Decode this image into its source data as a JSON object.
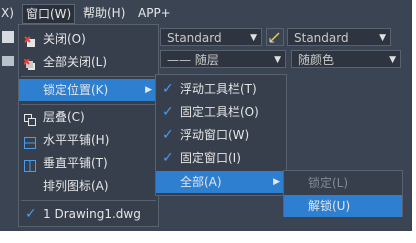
{
  "menubar": {
    "items": [
      {
        "label": "X)"
      },
      {
        "label": "窗口(W)"
      },
      {
        "label": "帮助(H)"
      },
      {
        "label": "APP+"
      }
    ]
  },
  "toolbar": {
    "combo_standard_1": "Standard",
    "combo_standard_2": "Standard",
    "combo_layer": "—— 随层",
    "combo_color": "随颜色"
  },
  "window_menu": {
    "items": [
      {
        "label": "关闭(O)"
      },
      {
        "label": "全部关闭(L)"
      },
      {
        "label": "锁定位置(K)"
      },
      {
        "label": "层叠(C)"
      },
      {
        "label": "水平平铺(H)"
      },
      {
        "label": "垂直平铺(T)"
      },
      {
        "label": "排列图标(A)"
      },
      {
        "label": "1 Drawing1.dwg"
      }
    ]
  },
  "lock_submenu": {
    "items": [
      {
        "label": "浮动工具栏(T)"
      },
      {
        "label": "固定工具栏(O)"
      },
      {
        "label": "浮动窗口(W)"
      },
      {
        "label": "固定窗口(I)"
      },
      {
        "label": "全部(A)"
      }
    ]
  },
  "all_submenu": {
    "items": [
      {
        "label": "锁定(L)"
      },
      {
        "label": "解锁(U)"
      }
    ]
  },
  "colors": {
    "accent": "#2f7fd1",
    "menu_bg": "#373f4c",
    "app_bg": "#3b4453",
    "check": "#4a9be8"
  }
}
